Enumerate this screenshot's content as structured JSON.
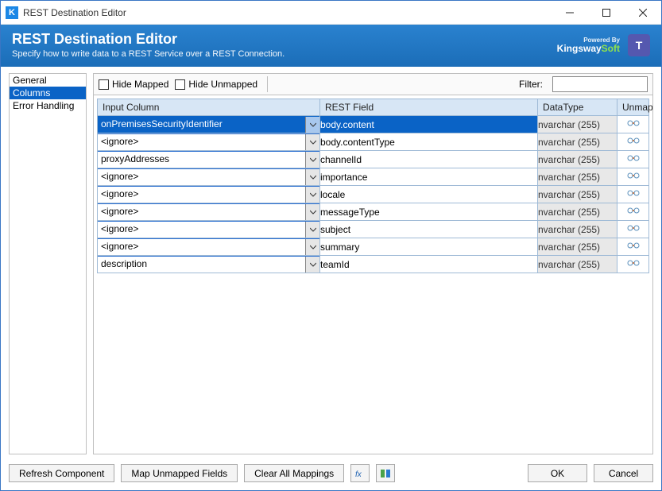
{
  "window": {
    "title": "REST Destination Editor",
    "app_icon_letter": "K"
  },
  "header": {
    "title": "REST Destination Editor",
    "subtitle": "Specify how to write data to a REST Service over a REST Connection.",
    "logo_powered": "Powered By",
    "logo_brand_a": "Kingsway",
    "logo_brand_b": "Soft",
    "teams_letter": "T"
  },
  "sidebar": {
    "items": [
      {
        "label": "General",
        "selected": false
      },
      {
        "label": "Columns",
        "selected": true
      },
      {
        "label": "Error Handling",
        "selected": false
      }
    ]
  },
  "toolbar": {
    "hide_mapped": "Hide Mapped",
    "hide_unmapped": "Hide Unmapped",
    "filter_label": "Filter:",
    "filter_value": ""
  },
  "grid": {
    "headers": {
      "input": "Input Column",
      "rest": "REST Field",
      "dtype": "DataType",
      "unmap": "Unmap"
    },
    "rows": [
      {
        "input": "onPremisesSecurityIdentifier",
        "rest": "body.content",
        "dtype": "nvarchar (255)",
        "selected": true
      },
      {
        "input": "<ignore>",
        "rest": "body.contentType",
        "dtype": "nvarchar (255)",
        "selected": false
      },
      {
        "input": "proxyAddresses",
        "rest": "channelId",
        "dtype": "nvarchar (255)",
        "selected": false
      },
      {
        "input": "<ignore>",
        "rest": "importance",
        "dtype": "nvarchar (255)",
        "selected": false
      },
      {
        "input": "<ignore>",
        "rest": "locale",
        "dtype": "nvarchar (255)",
        "selected": false
      },
      {
        "input": "<ignore>",
        "rest": "messageType",
        "dtype": "nvarchar (255)",
        "selected": false
      },
      {
        "input": "<ignore>",
        "rest": "subject",
        "dtype": "nvarchar (255)",
        "selected": false
      },
      {
        "input": "<ignore>",
        "rest": "summary",
        "dtype": "nvarchar (255)",
        "selected": false
      },
      {
        "input": "description",
        "rest": "teamId",
        "dtype": "nvarchar (255)",
        "selected": false
      }
    ]
  },
  "footer": {
    "refresh": "Refresh Component",
    "map_unmapped": "Map Unmapped Fields",
    "clear_all": "Clear All Mappings",
    "ok": "OK",
    "cancel": "Cancel"
  }
}
